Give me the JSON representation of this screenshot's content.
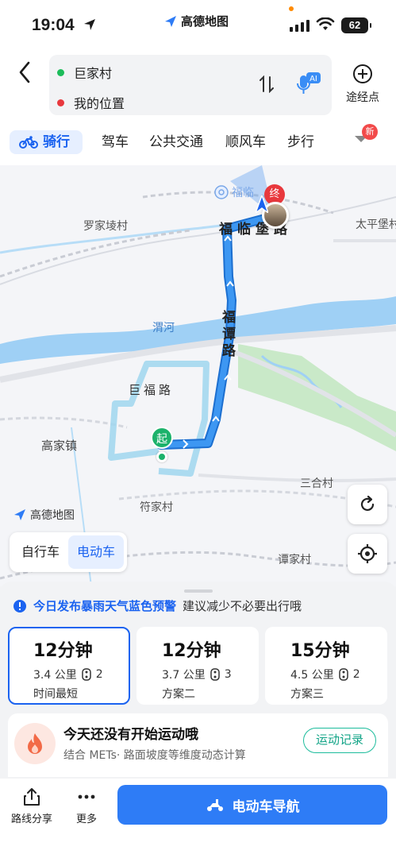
{
  "status_bar": {
    "time": "19:04",
    "app_brand": "高德地图",
    "battery": "62"
  },
  "header": {
    "origin": "巨家村",
    "destination": "我的位置",
    "origin_color": "#1cbc5a",
    "destination_color": "#e8383d",
    "ai_badge": "AI",
    "via_label": "途经点"
  },
  "transport_tabs": {
    "items": [
      "骑行",
      "驾车",
      "公共交通",
      "顺风车",
      "步行"
    ],
    "active": "骑行",
    "new_badge": "新"
  },
  "map": {
    "labels": [
      "罗家堎村",
      "太平堡村",
      "渭河",
      "高家镇",
      "三合村",
      "符家村",
      "谭家村"
    ],
    "road_labels": [
      "福临堡路",
      "福谭路",
      "巨福路"
    ],
    "station_label": "福临",
    "end_marker": "终",
    "start_marker": "起",
    "logo_text": "高德地图",
    "route_color": "#2f8cf0"
  },
  "vehicle_toggle": {
    "options": [
      "自行车",
      "电动车"
    ],
    "selected": "电动车"
  },
  "sheet": {
    "alert_highlight": "今日发布暴雨天气蓝色预警",
    "alert_text": "建议减少不必要出行哦",
    "routes": [
      {
        "time": "12分钟",
        "distance": "3.4 公里",
        "lights": "2",
        "tag": "时间最短"
      },
      {
        "time": "12分钟",
        "distance": "3.7 公里",
        "lights": "3",
        "tag": "方案二"
      },
      {
        "time": "15分钟",
        "distance": "4.5 公里",
        "lights": "2",
        "tag": "方案三"
      }
    ],
    "sport_title": "今天还没有开始运动哦",
    "sport_sub": "结合 METs· 路面坡度等维度动态计算",
    "sport_button": "运动记录"
  },
  "bottom_bar": {
    "share_label": "路线分享",
    "more_label": "更多",
    "nav_label": "电动车导航"
  },
  "colors": {
    "accent": "#1b63f0",
    "nav_button": "#2e7cf6",
    "sport_green": "#1cbc9c"
  }
}
